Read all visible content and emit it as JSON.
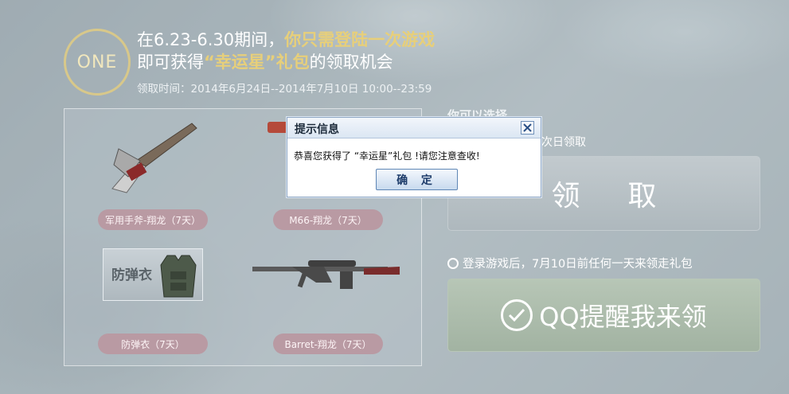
{
  "header": {
    "badge": "ONE",
    "line1_prefix": "在6.23-6.30期间，",
    "line1_highlight": "你只需登陆一次游戏",
    "line2_prefix": "即可获得",
    "line2_highlight": "“幸运星”礼包",
    "line2_suffix": "的领取机会",
    "date_range": "领取时间：2014年6月24日--2014年7月10日 10:00--23:59"
  },
  "items": [
    {
      "label": "军用手斧-翔龙（7天）"
    },
    {
      "label": "M66-翔龙（7天）"
    },
    {
      "label": "防弹衣（7天）",
      "image_text": "防弹衣"
    },
    {
      "label": "Barret-翔龙（7天）"
    }
  ],
  "right": {
    "title_partial": "你可以选择",
    "subtitle_partial": "次日领取",
    "claim_button": "领取",
    "radio_option": "登录游戏后，7月10日前任何一天来领走礼包",
    "qq_button": "QQ提醒我来领"
  },
  "dialog": {
    "title": "提示信息",
    "message": "恭喜您获得了 “幸运星”礼包 !请您注意查收!",
    "ok_button": "确 定",
    "close_icon": "close-icon"
  },
  "colors": {
    "highlight_gold": "#e7cf7a",
    "pill_bg": "#b99aa3",
    "dialog_border": "#8fa7c4"
  }
}
